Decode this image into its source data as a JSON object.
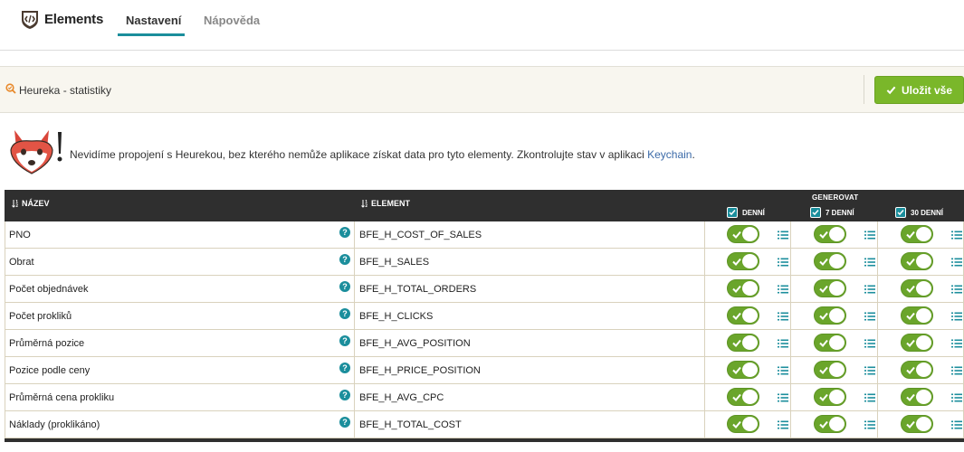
{
  "app": {
    "brand": "Elements"
  },
  "nav": {
    "tabs": [
      {
        "label": "Nastavení",
        "active": true
      },
      {
        "label": "Nápověda",
        "active": false
      }
    ]
  },
  "toolbar": {
    "title": "Heureka - statistiky",
    "save_label": "Uložit vše"
  },
  "alert": {
    "message": "Nevidíme propojení s Heurekou, bez kterého nemůže aplikace získat data pro tyto elementy. Zkontrolujte stav v aplikaci ",
    "link": "Keychain",
    "end": "."
  },
  "table": {
    "col_name": "NÁZEV",
    "col_element": "ELEMENT",
    "group_label": "GENEROVAT",
    "gen_cols": [
      {
        "label": "DENNÍ",
        "checked": true
      },
      {
        "label": "7 DENNÍ",
        "checked": true
      },
      {
        "label": "30 DENNÍ",
        "checked": true
      }
    ],
    "rows": [
      {
        "name": "PNO",
        "element": "BFE_H_COST_OF_SALES",
        "toggles": [
          true,
          true,
          true
        ]
      },
      {
        "name": "Obrat",
        "element": "BFE_H_SALES",
        "toggles": [
          true,
          true,
          true
        ]
      },
      {
        "name": "Počet objednávek",
        "element": "BFE_H_TOTAL_ORDERS",
        "toggles": [
          true,
          true,
          true
        ]
      },
      {
        "name": "Počet prokliků",
        "element": "BFE_H_CLICKS",
        "toggles": [
          true,
          true,
          true
        ]
      },
      {
        "name": "Průměrná pozice",
        "element": "BFE_H_AVG_POSITION",
        "toggles": [
          true,
          true,
          true
        ]
      },
      {
        "name": "Pozice podle ceny",
        "element": "BFE_H_PRICE_POSITION",
        "toggles": [
          true,
          true,
          true
        ]
      },
      {
        "name": "Průměrná cena prokliku",
        "element": "BFE_H_AVG_CPC",
        "toggles": [
          true,
          true,
          true
        ]
      },
      {
        "name": "Náklady (proklikáno)",
        "element": "BFE_H_TOTAL_COST",
        "toggles": [
          true,
          true,
          true
        ]
      }
    ]
  },
  "icons": {
    "logo": "code-bracket-badge-icon",
    "page": "heureka-logo-icon",
    "help": "question-mark-icon",
    "list": "list-icon",
    "check": "check-icon",
    "sort": "sort-icon"
  },
  "colors": {
    "accent": "#1b8e9c",
    "save": "#7ab72a",
    "toggle_on": "#6aa52b",
    "header_bg": "#2f2f2f"
  }
}
